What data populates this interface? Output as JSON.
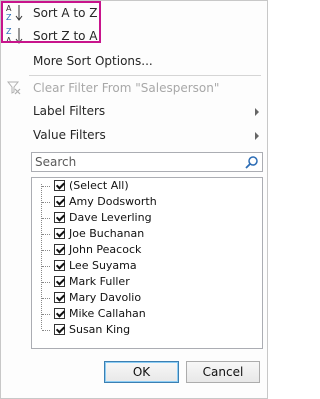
{
  "menu": {
    "sort_asc": "Sort A to Z",
    "sort_desc": "Sort Z to A",
    "more_sort": "More Sort Options...",
    "clear_filter": "Clear Filter From \"Salesperson\"",
    "label_filters": "Label Filters",
    "value_filters": "Value Filters"
  },
  "search": {
    "placeholder": "Search"
  },
  "list": {
    "items": [
      "(Select All)",
      "Amy Dodsworth",
      "Dave Leverling",
      "Joe Buchanan",
      "John Peacock",
      "Lee Suyama",
      "Mark Fuller",
      "Mary Davolio",
      "Mike Callahan",
      "Susan King"
    ]
  },
  "buttons": {
    "ok": "OK",
    "cancel": "Cancel"
  },
  "colors": {
    "highlight": "#c8148c",
    "az_blue": "#2b6cb5"
  }
}
